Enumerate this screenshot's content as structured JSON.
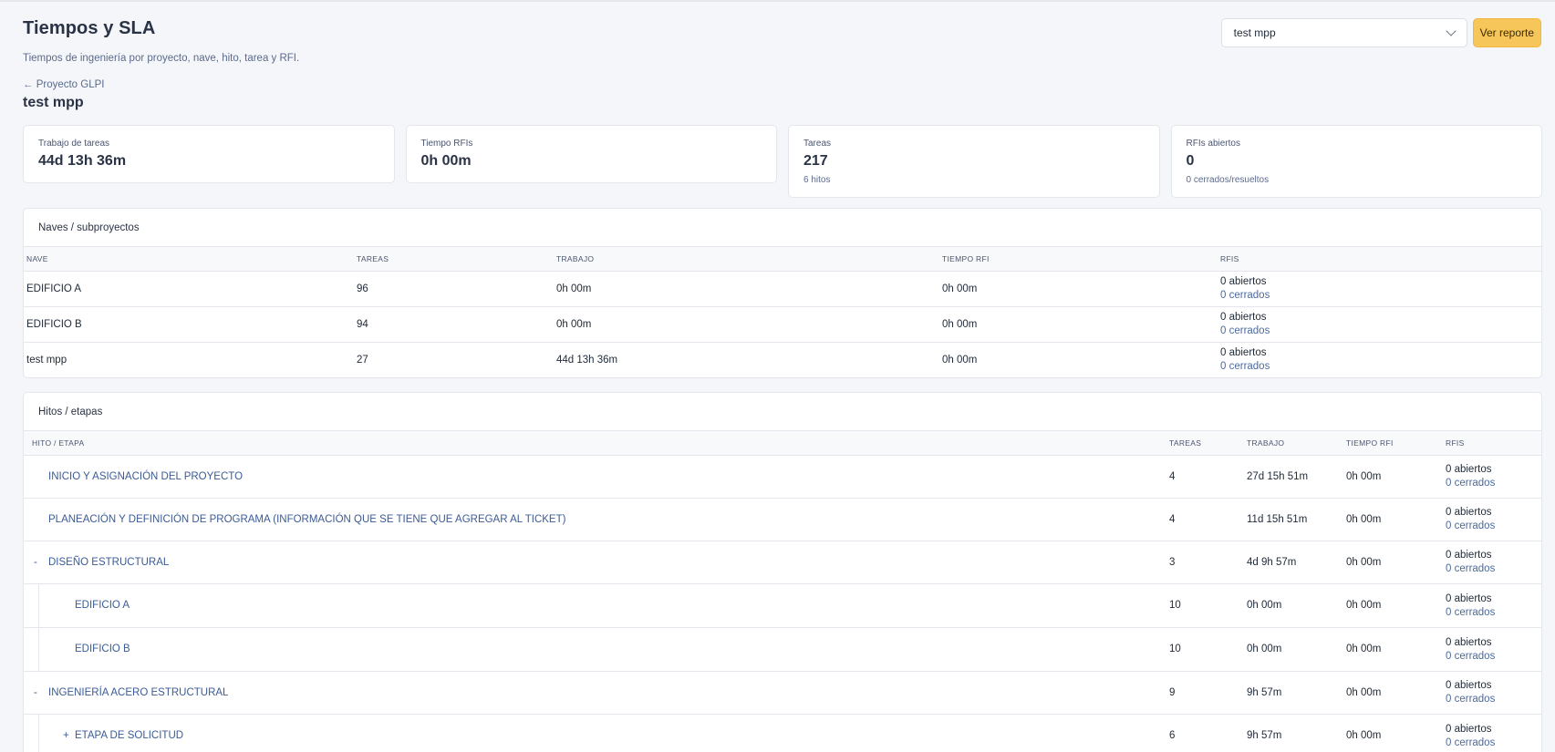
{
  "header": {
    "title": "Tiempos y SLA",
    "subtitle": "Tiempos de ingeniería por proyecto, nave, hito, tarea y RFI.",
    "project_select": "test mpp",
    "report_button": "Ver reporte"
  },
  "breadcrumb": {
    "back_label": "← Proyecto GLPI"
  },
  "project_name": "test mpp",
  "cards": [
    {
      "label": "Trabajo de tareas",
      "value": "44d 13h 36m",
      "sub": ""
    },
    {
      "label": "Tiempo RFIs",
      "value": "0h 00m",
      "sub": ""
    },
    {
      "label": "Tareas",
      "value": "217",
      "sub": "6 hitos"
    },
    {
      "label": "RFIs abiertos",
      "value": "0",
      "sub": "0 cerrados/resueltos"
    }
  ],
  "naves": {
    "title": "Naves / subproyectos",
    "columns": [
      "NAVE",
      "TAREAS",
      "TRABAJO",
      "TIEMPO RFI",
      "RFIS"
    ],
    "rows": [
      {
        "nave": "EDIFICIO A",
        "tareas": "96",
        "trabajo": "0h 00m",
        "tiempo_rfi": "0h 00m",
        "rfi_open": "0 abiertos",
        "rfi_closed": "0 cerrados"
      },
      {
        "nave": "EDIFICIO B",
        "tareas": "94",
        "trabajo": "0h 00m",
        "tiempo_rfi": "0h 00m",
        "rfi_open": "0 abiertos",
        "rfi_closed": "0 cerrados"
      },
      {
        "nave": "test mpp",
        "tareas": "27",
        "trabajo": "44d 13h 36m",
        "tiempo_rfi": "0h 00m",
        "rfi_open": "0 abiertos",
        "rfi_closed": "0 cerrados"
      }
    ]
  },
  "hitos": {
    "title": "Hitos / etapas",
    "columns": [
      "HITO / ETAPA",
      "TAREAS",
      "TRABAJO",
      "TIEMPO RFI",
      "RFIS"
    ],
    "rows": [
      {
        "toggle": "",
        "name": "INICIO Y ASIGNACIÓN DEL PROYECTO",
        "tareas": "4",
        "trabajo": "27d 15h 51m",
        "tiempo_rfi": "0h 00m",
        "rfi_open": "0 abiertos",
        "rfi_closed": "0 cerrados"
      },
      {
        "toggle": "",
        "name": "PLANEACIÓN Y DEFINICIÓN DE PROGRAMA (INFORMACIÓN QUE SE TIENE QUE AGREGAR AL TICKET)",
        "tareas": "4",
        "trabajo": "11d 15h 51m",
        "tiempo_rfi": "0h 00m",
        "rfi_open": "0 abiertos",
        "rfi_closed": "0 cerrados"
      },
      {
        "toggle": "-",
        "name": "DISEÑO ESTRUCTURAL",
        "tareas": "3",
        "trabajo": "4d 9h 57m",
        "tiempo_rfi": "0h 00m",
        "rfi_open": "0 abiertos",
        "rfi_closed": "0 cerrados"
      },
      {
        "toggle": "",
        "name": "EDIFICIO A",
        "tareas": "10",
        "trabajo": "0h 00m",
        "tiempo_rfi": "0h 00m",
        "rfi_open": "0 abiertos",
        "rfi_closed": "0 cerrados"
      },
      {
        "toggle": "",
        "name": "EDIFICIO B",
        "tareas": "10",
        "trabajo": "0h 00m",
        "tiempo_rfi": "0h 00m",
        "rfi_open": "0 abiertos",
        "rfi_closed": "0 cerrados"
      },
      {
        "toggle": "-",
        "name": "INGENIERÍA ACERO ESTRUCTURAL",
        "tareas": "9",
        "trabajo": "9h 57m",
        "tiempo_rfi": "0h 00m",
        "rfi_open": "0 abiertos",
        "rfi_closed": "0 cerrados"
      },
      {
        "toggle": "+",
        "name": "ETAPA DE SOLICITUD",
        "tareas": "6",
        "trabajo": "9h 57m",
        "tiempo_rfi": "0h 00m",
        "rfi_open": "0 abiertos",
        "rfi_closed": "0 cerrados"
      }
    ]
  },
  "colors": {
    "accent_button": "#f7c65a",
    "link": "#3b5b95",
    "background": "#f4f6fa"
  }
}
